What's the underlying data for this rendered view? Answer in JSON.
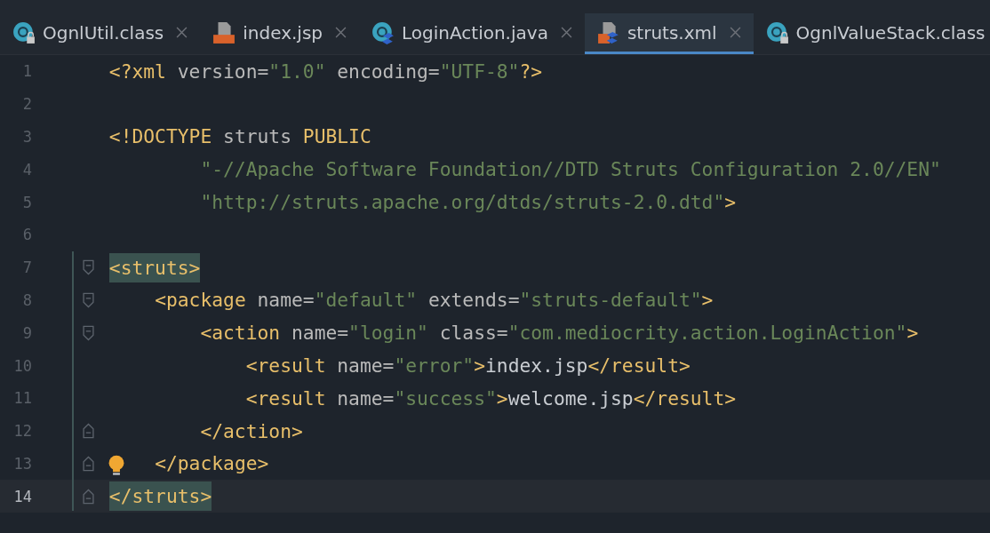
{
  "tabs": [
    {
      "label": "OgnlUtil.class",
      "kind": "class",
      "closable": true,
      "selected": false
    },
    {
      "label": "index.jsp",
      "kind": "jsp",
      "closable": true,
      "selected": false
    },
    {
      "label": "LoginAction.java",
      "kind": "action",
      "closable": true,
      "selected": false
    },
    {
      "label": "struts.xml",
      "kind": "xml",
      "closable": true,
      "selected": true
    },
    {
      "label": "OgnlValueStack.class",
      "kind": "class",
      "closable": false,
      "selected": false
    }
  ],
  "lines": [
    {
      "number": "1",
      "kind": "plain",
      "current": false,
      "hint": false,
      "tokens": [
        {
          "kind": "tag",
          "text": "<?xml"
        },
        {
          "kind": "attr",
          "text": " version="
        },
        {
          "kind": "value",
          "text": "\"1.0\""
        },
        {
          "kind": "attr",
          "text": " encoding="
        },
        {
          "kind": "value",
          "text": "\"UTF-8\""
        },
        {
          "kind": "tag",
          "text": "?>"
        }
      ]
    },
    {
      "number": "2",
      "kind": "plain",
      "current": false,
      "hint": false
    },
    {
      "number": "3",
      "kind": "plain",
      "current": false,
      "hint": false,
      "tokens": [
        {
          "kind": "tag",
          "text": "<!DOCTYPE"
        },
        {
          "kind": "attr",
          "text": " struts "
        },
        {
          "kind": "tag",
          "text": "PUBLIC"
        }
      ]
    },
    {
      "number": "4",
      "kind": "plain",
      "current": false,
      "hint": false,
      "tokens": [
        {
          "kind": "value",
          "text": "        \"-//Apache Software Foundation//DTD Struts Configuration 2.0//EN\""
        }
      ]
    },
    {
      "number": "5",
      "kind": "plain",
      "current": false,
      "hint": false,
      "tokens": [
        {
          "kind": "value",
          "text": "        \"http://struts.apache.org/dtds/struts-2.0.dtd\""
        },
        {
          "kind": "tag",
          "text": ">"
        }
      ]
    },
    {
      "number": "6",
      "kind": "plain",
      "current": false,
      "hint": false
    },
    {
      "number": "7",
      "kind": "fold-start",
      "current": false,
      "hint": false,
      "tokens": [
        {
          "kind": "match",
          "text": "<struts>"
        }
      ]
    },
    {
      "number": "8",
      "kind": "fold-start",
      "current": false,
      "hint": false,
      "tokens": [
        {
          "kind": "tag",
          "text": "    <package"
        },
        {
          "kind": "attr",
          "text": " name="
        },
        {
          "kind": "value",
          "text": "\"default\""
        },
        {
          "kind": "attr",
          "text": " extends="
        },
        {
          "kind": "value",
          "text": "\"struts-default\""
        },
        {
          "kind": "tag",
          "text": ">"
        }
      ]
    },
    {
      "number": "9",
      "kind": "fold-start",
      "current": false,
      "hint": false,
      "tokens": [
        {
          "kind": "tag",
          "text": "        <action"
        },
        {
          "kind": "attr",
          "text": " name="
        },
        {
          "kind": "value",
          "text": "\"login\""
        },
        {
          "kind": "attr",
          "text": " class="
        },
        {
          "kind": "value",
          "text": "\"com.mediocrity.action.LoginAction\""
        },
        {
          "kind": "tag",
          "text": ">"
        }
      ]
    },
    {
      "number": "10",
      "kind": "plain",
      "current": false,
      "hint": false,
      "tokens": [
        {
          "kind": "tag",
          "text": "            <result"
        },
        {
          "kind": "attr",
          "text": " name="
        },
        {
          "kind": "value",
          "text": "\"error\""
        },
        {
          "kind": "tag",
          "text": ">"
        },
        {
          "kind": "text",
          "text": "index.jsp"
        },
        {
          "kind": "tag",
          "text": "</result>"
        }
      ]
    },
    {
      "number": "11",
      "kind": "plain",
      "current": false,
      "hint": false,
      "tokens": [
        {
          "kind": "tag",
          "text": "            <result"
        },
        {
          "kind": "attr",
          "text": " name="
        },
        {
          "kind": "value",
          "text": "\"success\""
        },
        {
          "kind": "tag",
          "text": ">"
        },
        {
          "kind": "text",
          "text": "welcome.jsp"
        },
        {
          "kind": "tag",
          "text": "</result>"
        }
      ]
    },
    {
      "number": "12",
      "kind": "fold-end",
      "current": false,
      "hint": false,
      "tokens": [
        {
          "kind": "tag",
          "text": "        </action>"
        }
      ]
    },
    {
      "number": "13",
      "kind": "fold-end",
      "current": false,
      "hint": true,
      "tokens": [
        {
          "kind": "tag",
          "text": "    </package>"
        }
      ]
    },
    {
      "number": "14",
      "kind": "fold-end",
      "current": true,
      "hint": false,
      "tokens": [
        {
          "kind": "match",
          "text": "</struts>"
        }
      ]
    }
  ]
}
